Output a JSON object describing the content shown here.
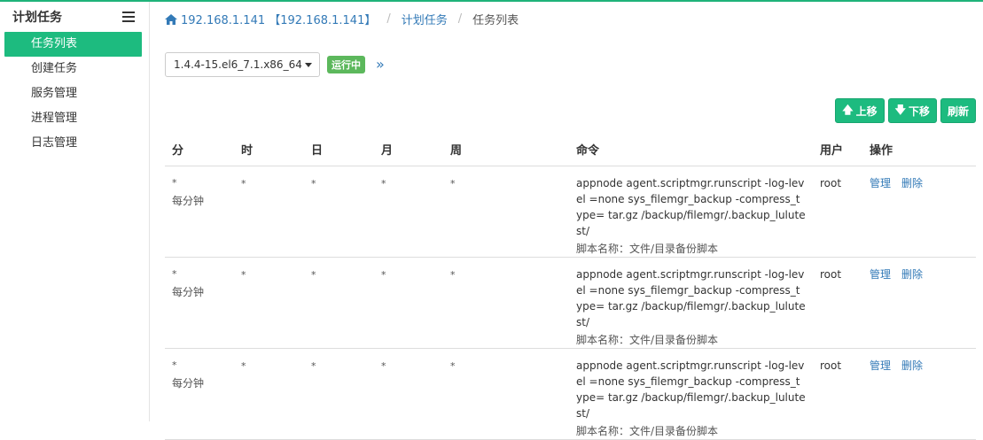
{
  "sidebar": {
    "title": "计划任务",
    "items": [
      {
        "label": "任务列表",
        "active": true
      },
      {
        "label": "创建任务",
        "active": false
      },
      {
        "label": "服务管理",
        "active": false
      },
      {
        "label": "进程管理",
        "active": false
      },
      {
        "label": "日志管理",
        "active": false
      }
    ]
  },
  "breadcrumb": {
    "host": "192.168.1.141 【192.168.1.141】",
    "section": "计划任务",
    "current": "任务列表"
  },
  "toolbar": {
    "version_selected": "1.4.4-15.el6_7.1.x86_64",
    "status_badge": "运行中",
    "expand_glyph": "»"
  },
  "actions": {
    "up_label": "上移",
    "down_label": "下移",
    "refresh_label": "刷新"
  },
  "table": {
    "headers": [
      "分",
      "时",
      "日",
      "月",
      "周",
      "命令",
      "用户",
      "操作"
    ],
    "rows": [
      {
        "min": "*",
        "min_desc": "每分钟",
        "hour": "*",
        "day": "*",
        "month": "*",
        "week": "*",
        "command": "appnode agent.scriptmgr.runscript -log-level =none sys_filemgr_backup -compress_type= tar.gz /backup/filemgr/.backup_lulutest/",
        "script": "脚本名称：文件/目录备份脚本",
        "user": "root",
        "manage": "管理",
        "delete": "删除"
      },
      {
        "min": "*",
        "min_desc": "每分钟",
        "hour": "*",
        "day": "*",
        "month": "*",
        "week": "*",
        "command": "appnode agent.scriptmgr.runscript -log-level =none sys_filemgr_backup -compress_type= tar.gz /backup/filemgr/.backup_lulutest/",
        "script": "脚本名称：文件/目录备份脚本",
        "user": "root",
        "manage": "管理",
        "delete": "删除"
      },
      {
        "min": "*",
        "min_desc": "每分钟",
        "hour": "*",
        "day": "*",
        "month": "*",
        "week": "*",
        "command": "appnode agent.scriptmgr.runscript -log-level =none sys_filemgr_backup -compress_type= tar.gz /backup/filemgr/.backup_lulutest/",
        "script": "脚本名称：文件/目录备份脚本",
        "user": "root",
        "manage": "管理",
        "delete": "删除"
      }
    ]
  },
  "colors": {
    "accent": "#1dbb7f",
    "link": "#337ab7",
    "badge": "#5cb85c"
  }
}
